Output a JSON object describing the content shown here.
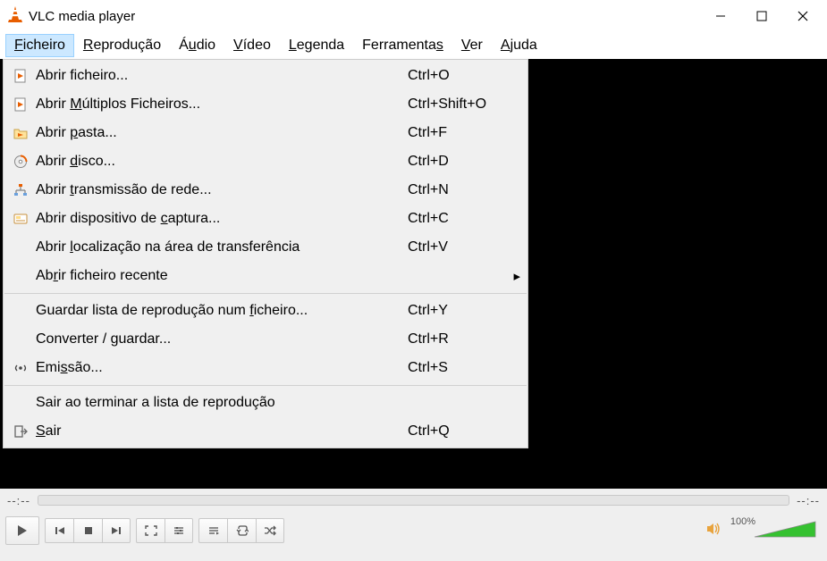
{
  "title": "VLC media player",
  "menubar": [
    {
      "label": "Ficheiro",
      "ul": "F",
      "active": true
    },
    {
      "label": "Reprodução",
      "ul": "R"
    },
    {
      "label": "Áudio",
      "ul": "u"
    },
    {
      "label": "Vídeo",
      "ul": "V"
    },
    {
      "label": "Legenda",
      "ul": "L"
    },
    {
      "label": "Ferramentas",
      "ul": "s"
    },
    {
      "label": "Ver",
      "ul": "V"
    },
    {
      "label": "Ajuda",
      "ul": "A"
    }
  ],
  "dropdown": [
    {
      "icon": "file-play",
      "label": "Abrir ficheiro...",
      "ul": "",
      "shortcut": "Ctrl+O"
    },
    {
      "icon": "file-play",
      "label": "Abrir Múltiplos Ficheiros...",
      "ul": "M",
      "shortcut": "Ctrl+Shift+O"
    },
    {
      "icon": "folder",
      "label": "Abrir pasta...",
      "ul": "p",
      "shortcut": "Ctrl+F"
    },
    {
      "icon": "disc",
      "label": "Abrir disco...",
      "ul": "d",
      "shortcut": "Ctrl+D"
    },
    {
      "icon": "network",
      "label": "Abrir transmissão de rede...",
      "ul": "t",
      "shortcut": "Ctrl+N"
    },
    {
      "icon": "card",
      "label": "Abrir dispositivo de captura...",
      "ul": "c",
      "shortcut": "Ctrl+C"
    },
    {
      "icon": "",
      "label": "Abrir localização na área de transferência",
      "ul": "l",
      "shortcut": "Ctrl+V"
    },
    {
      "icon": "",
      "label": "Abrir ficheiro recente",
      "ul": "r",
      "shortcut": "",
      "submenu": true
    },
    {
      "sep": true
    },
    {
      "icon": "",
      "label": "Guardar lista de reprodução num ficheiro...",
      "ul": "f",
      "shortcut": "Ctrl+Y"
    },
    {
      "icon": "",
      "label": "Converter / guardar...",
      "ul": "g",
      "shortcut": "Ctrl+R"
    },
    {
      "icon": "stream",
      "label": "Emissão...",
      "ul": "s",
      "shortcut": "Ctrl+S"
    },
    {
      "sep": true
    },
    {
      "icon": "",
      "label": "Sair ao terminar a lista de reprodução",
      "ul": "",
      "shortcut": ""
    },
    {
      "icon": "exit",
      "label": "Sair",
      "ul": "S",
      "shortcut": "Ctrl+Q"
    }
  ],
  "time_left": "--:--",
  "time_right": "--:--",
  "volume_pct": "100%"
}
